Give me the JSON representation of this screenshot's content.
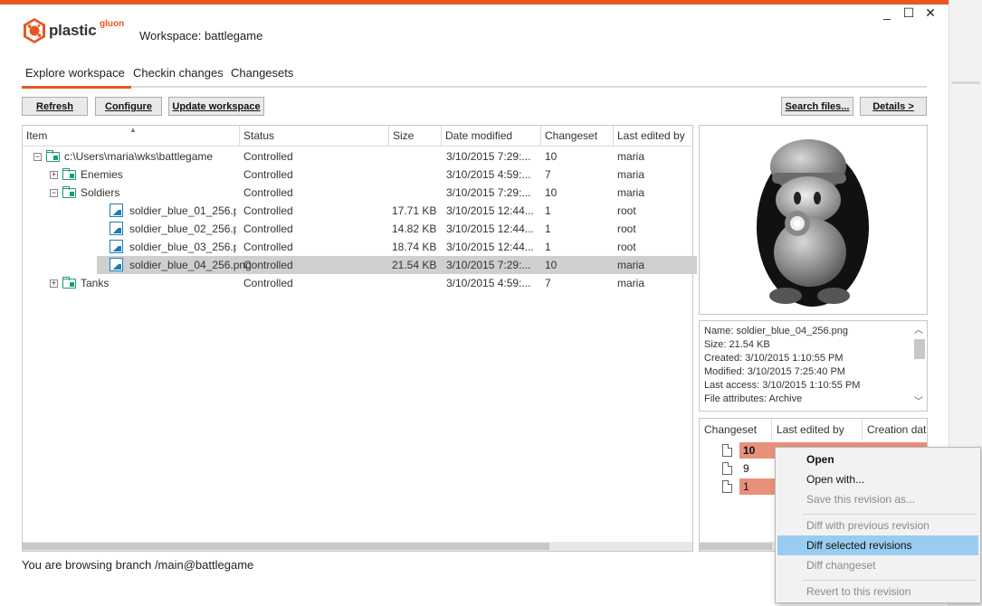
{
  "window": {
    "minimize": "_",
    "maximize": "☐",
    "close": "✕"
  },
  "logo": {
    "name": "plastic",
    "suffix": "gluon"
  },
  "workspace_title": "Workspace: battlegame",
  "tabs": [
    {
      "label": "Explore workspace",
      "active": true
    },
    {
      "label": "Checkin changes",
      "active": false
    },
    {
      "label": "Changesets",
      "active": false
    }
  ],
  "toolbar": {
    "refresh": "Refresh",
    "configure": "Configure",
    "update_workspace": "Update workspace",
    "search_files": "Search files...",
    "details": "Details >"
  },
  "grid": {
    "columns": [
      "Item",
      "Status",
      "Size",
      "Date modified",
      "Changeset",
      "Last edited by"
    ],
    "rows": [
      {
        "name": "c:\\Users\\maria\\wks\\battlegame",
        "expander": "⊟",
        "type": "folder",
        "status": "Controlled",
        "size": "",
        "date": "3/10/2015 7:29:...",
        "changeset": "10",
        "editor": "maria"
      },
      {
        "name": "Enemies",
        "expander": "⊞",
        "type": "folder",
        "status": "Controlled",
        "size": "",
        "date": "3/10/2015 4:59:...",
        "changeset": "7",
        "editor": "maria"
      },
      {
        "name": "Soldiers",
        "expander": "⊟",
        "type": "folder",
        "status": "Controlled",
        "size": "",
        "date": "3/10/2015 7:29:...",
        "changeset": "10",
        "editor": "maria"
      },
      {
        "name": "soldier_blue_01_256.png",
        "expander": "",
        "type": "image",
        "status": "Controlled",
        "size": "17.71 KB",
        "date": "3/10/2015 12:44...",
        "changeset": "1",
        "editor": "root"
      },
      {
        "name": "soldier_blue_02_256.png",
        "expander": "",
        "type": "image",
        "status": "Controlled",
        "size": "14.82 KB",
        "date": "3/10/2015 12:44...",
        "changeset": "1",
        "editor": "root"
      },
      {
        "name": "soldier_blue_03_256.png",
        "expander": "",
        "type": "image",
        "status": "Controlled",
        "size": "18.74 KB",
        "date": "3/10/2015 12:44...",
        "changeset": "1",
        "editor": "root"
      },
      {
        "name": "soldier_blue_04_256.png",
        "expander": "",
        "type": "image",
        "status": "Controlled",
        "size": "21.54 KB",
        "date": "3/10/2015 7:29:...",
        "changeset": "10",
        "editor": "maria",
        "selected": true
      },
      {
        "name": "Tanks",
        "expander": "⊞",
        "type": "folder",
        "status": "Controlled",
        "size": "",
        "date": "3/10/2015 4:59:...",
        "changeset": "7",
        "editor": "maria"
      }
    ]
  },
  "file_info": [
    "Name: soldier_blue_04_256.png",
    "Size: 21.54 KB",
    "Created: 3/10/2015 1:10:55 PM",
    "Modified: 3/10/2015 7:25:40 PM",
    "Last access: 3/10/2015 1:10:55 PM",
    "File attributes: Archive"
  ],
  "history": {
    "columns": [
      "Changeset",
      "Last edited by",
      "Creation dat"
    ],
    "rows": [
      {
        "changeset": "10",
        "highlight": true,
        "bold": true
      },
      {
        "changeset": "9",
        "highlight": false,
        "bold": false
      },
      {
        "changeset": "1",
        "highlight": true,
        "bold": false
      }
    ]
  },
  "context_menu": [
    {
      "label": "Open",
      "bold": true,
      "disabled": false
    },
    {
      "label": "Open with...",
      "bold": false,
      "disabled": false
    },
    {
      "label": "Save this revision as...",
      "bold": false,
      "disabled": true
    },
    {
      "label": "Diff with previous revision",
      "bold": false,
      "disabled": true
    },
    {
      "label": "Diff selected revisions",
      "bold": false,
      "disabled": false,
      "hover": true
    },
    {
      "label": "Diff changeset",
      "bold": false,
      "disabled": true
    },
    {
      "label": "Revert to this revision",
      "bold": false,
      "disabled": true
    }
  ],
  "status_bar": "You are browsing branch /main@battlegame",
  "colors": {
    "accent": "#e8571f",
    "highlight_row": "#e8917a",
    "menu_hover": "#99ccf0",
    "icon_teal": "#1a9c7a"
  }
}
